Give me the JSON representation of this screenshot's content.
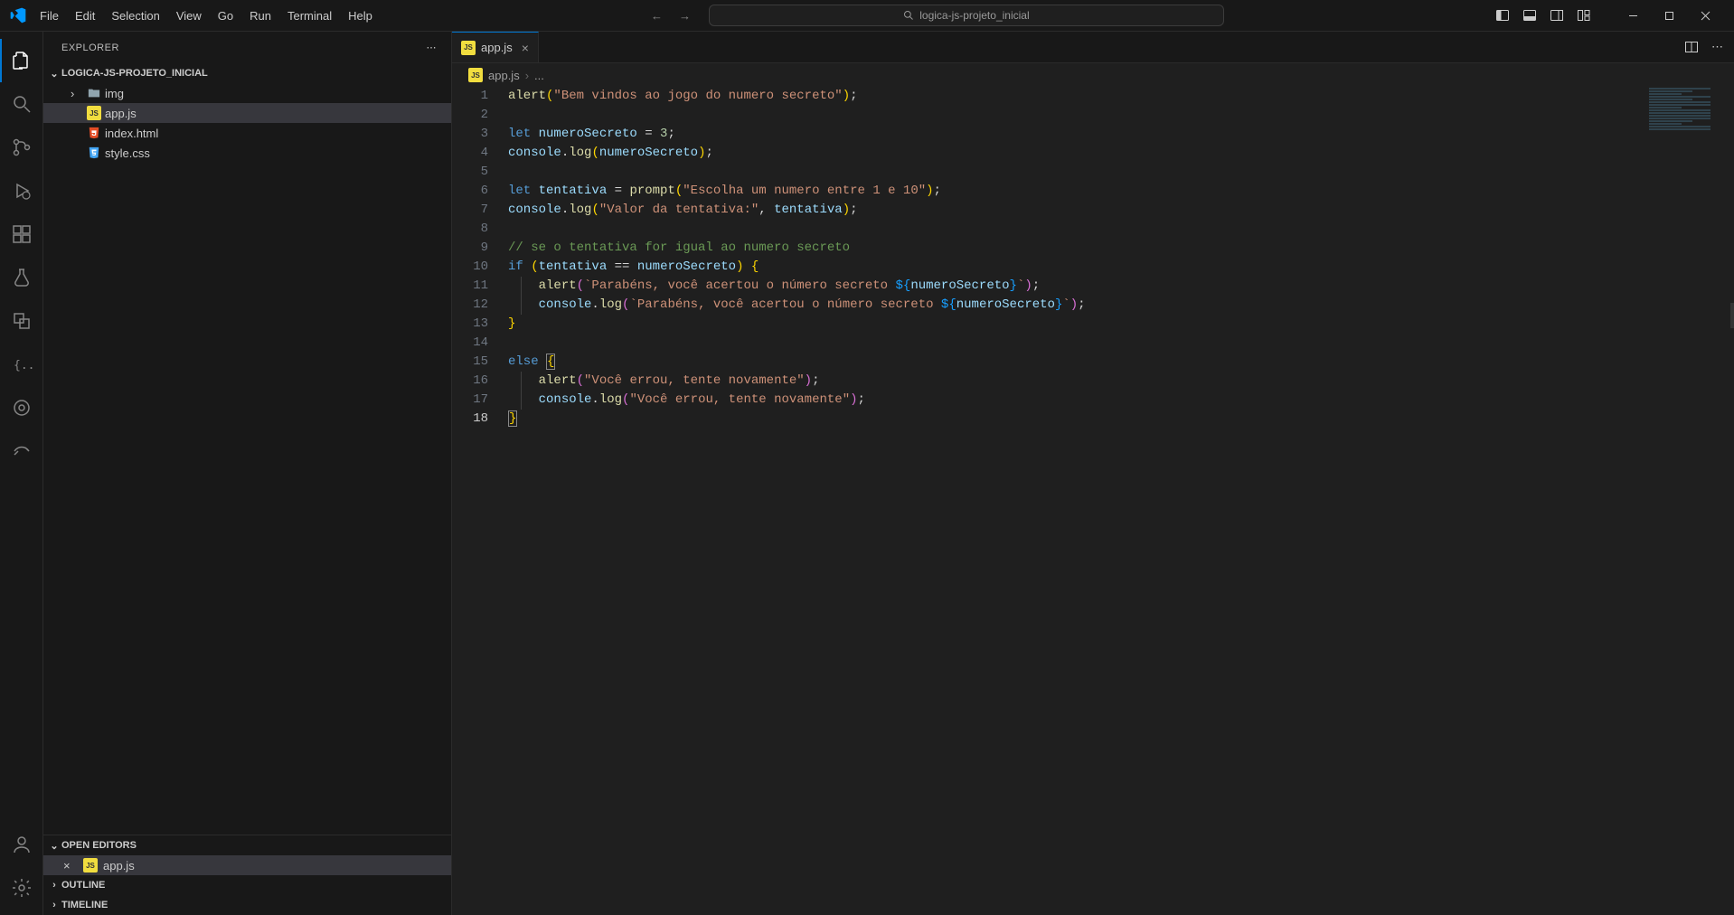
{
  "menu": [
    "File",
    "Edit",
    "Selection",
    "View",
    "Go",
    "Run",
    "Terminal",
    "Help"
  ],
  "search_placeholder": "logica-js-projeto_inicial",
  "sidebar": {
    "title": "EXPLORER",
    "project": "LOGICA-JS-PROJETO_INICIAL",
    "tree": {
      "folder": "img",
      "files": [
        "app.js",
        "index.html",
        "style.css"
      ]
    },
    "sections": {
      "open_editors": "OPEN EDITORS",
      "outline": "OUTLINE",
      "timeline": "TIMELINE"
    },
    "open_file": "app.js"
  },
  "tab": {
    "name": "app.js"
  },
  "breadcrumbs": {
    "file": "app.js",
    "rest": "..."
  },
  "code": {
    "lines": [
      {
        "n": 1,
        "segs": [
          {
            "t": "alert",
            "c": "tok-fn"
          },
          {
            "t": "(",
            "c": "tok-br"
          },
          {
            "t": "\"Bem vindos ao jogo do numero secreto\"",
            "c": "tok-str"
          },
          {
            "t": ")",
            "c": "tok-br"
          },
          {
            "t": ";",
            "c": "tok-pn"
          }
        ]
      },
      {
        "n": 2,
        "segs": []
      },
      {
        "n": 3,
        "segs": [
          {
            "t": "let ",
            "c": "tok-kw"
          },
          {
            "t": "numeroSecreto",
            "c": "tok-var"
          },
          {
            "t": " = ",
            "c": "tok-pn"
          },
          {
            "t": "3",
            "c": "tok-num"
          },
          {
            "t": ";",
            "c": "tok-pn"
          }
        ]
      },
      {
        "n": 4,
        "segs": [
          {
            "t": "console",
            "c": "tok-var"
          },
          {
            "t": ".",
            "c": "tok-pn"
          },
          {
            "t": "log",
            "c": "tok-fn"
          },
          {
            "t": "(",
            "c": "tok-br"
          },
          {
            "t": "numeroSecreto",
            "c": "tok-var"
          },
          {
            "t": ")",
            "c": "tok-br"
          },
          {
            "t": ";",
            "c": "tok-pn"
          }
        ]
      },
      {
        "n": 5,
        "segs": []
      },
      {
        "n": 6,
        "segs": [
          {
            "t": "let ",
            "c": "tok-kw"
          },
          {
            "t": "tentativa",
            "c": "tok-var"
          },
          {
            "t": " = ",
            "c": "tok-pn"
          },
          {
            "t": "prompt",
            "c": "tok-fn"
          },
          {
            "t": "(",
            "c": "tok-br"
          },
          {
            "t": "\"Escolha um numero entre 1 e 10\"",
            "c": "tok-str"
          },
          {
            "t": ")",
            "c": "tok-br"
          },
          {
            "t": ";",
            "c": "tok-pn"
          }
        ]
      },
      {
        "n": 7,
        "segs": [
          {
            "t": "console",
            "c": "tok-var"
          },
          {
            "t": ".",
            "c": "tok-pn"
          },
          {
            "t": "log",
            "c": "tok-fn"
          },
          {
            "t": "(",
            "c": "tok-br"
          },
          {
            "t": "\"Valor da tentativa:\"",
            "c": "tok-str"
          },
          {
            "t": ", ",
            "c": "tok-pn"
          },
          {
            "t": "tentativa",
            "c": "tok-var"
          },
          {
            "t": ")",
            "c": "tok-br"
          },
          {
            "t": ";",
            "c": "tok-pn"
          }
        ]
      },
      {
        "n": 8,
        "segs": []
      },
      {
        "n": 9,
        "segs": [
          {
            "t": "// se o tentativa for igual ao numero secreto",
            "c": "tok-cmt"
          }
        ]
      },
      {
        "n": 10,
        "segs": [
          {
            "t": "if ",
            "c": "tok-kw"
          },
          {
            "t": "(",
            "c": "tok-br"
          },
          {
            "t": "tentativa",
            "c": "tok-var"
          },
          {
            "t": " == ",
            "c": "tok-pn"
          },
          {
            "t": "numeroSecreto",
            "c": "tok-var"
          },
          {
            "t": ")",
            "c": "tok-br"
          },
          {
            "t": " ",
            "c": ""
          },
          {
            "t": "{",
            "c": "tok-br"
          }
        ]
      },
      {
        "n": 11,
        "indent": 1,
        "segs": [
          {
            "t": "    ",
            "c": ""
          },
          {
            "t": "alert",
            "c": "tok-fn"
          },
          {
            "t": "(",
            "c": "tok-br2"
          },
          {
            "t": "`Parabéns, você acertou o número secreto ",
            "c": "tok-tmpl"
          },
          {
            "t": "${",
            "c": "tok-br3"
          },
          {
            "t": "numeroSecreto",
            "c": "tok-var"
          },
          {
            "t": "}",
            "c": "tok-br3"
          },
          {
            "t": "`",
            "c": "tok-tmpl"
          },
          {
            "t": ")",
            "c": "tok-br2"
          },
          {
            "t": ";",
            "c": "tok-pn"
          }
        ]
      },
      {
        "n": 12,
        "indent": 1,
        "segs": [
          {
            "t": "    ",
            "c": ""
          },
          {
            "t": "console",
            "c": "tok-var"
          },
          {
            "t": ".",
            "c": "tok-pn"
          },
          {
            "t": "log",
            "c": "tok-fn"
          },
          {
            "t": "(",
            "c": "tok-br2"
          },
          {
            "t": "`Parabéns, você acertou o número secreto ",
            "c": "tok-tmpl"
          },
          {
            "t": "${",
            "c": "tok-br3"
          },
          {
            "t": "numeroSecreto",
            "c": "tok-var"
          },
          {
            "t": "}",
            "c": "tok-br3"
          },
          {
            "t": "`",
            "c": "tok-tmpl"
          },
          {
            "t": ")",
            "c": "tok-br2"
          },
          {
            "t": ";",
            "c": "tok-pn"
          }
        ]
      },
      {
        "n": 13,
        "segs": [
          {
            "t": "}",
            "c": "tok-br"
          }
        ]
      },
      {
        "n": 14,
        "segs": []
      },
      {
        "n": 15,
        "segs": [
          {
            "t": "else ",
            "c": "tok-kw"
          },
          {
            "t": "{",
            "c": "tok-br",
            "boxed": true
          }
        ]
      },
      {
        "n": 16,
        "indent": 1,
        "segs": [
          {
            "t": "    ",
            "c": ""
          },
          {
            "t": "alert",
            "c": "tok-fn"
          },
          {
            "t": "(",
            "c": "tok-br2"
          },
          {
            "t": "\"Você errou, tente novamente\"",
            "c": "tok-str"
          },
          {
            "t": ")",
            "c": "tok-br2"
          },
          {
            "t": ";",
            "c": "tok-pn"
          }
        ]
      },
      {
        "n": 17,
        "indent": 1,
        "segs": [
          {
            "t": "    ",
            "c": ""
          },
          {
            "t": "console",
            "c": "tok-var"
          },
          {
            "t": ".",
            "c": "tok-pn"
          },
          {
            "t": "log",
            "c": "tok-fn"
          },
          {
            "t": "(",
            "c": "tok-br2"
          },
          {
            "t": "\"Você errou, tente novamente\"",
            "c": "tok-str"
          },
          {
            "t": ")",
            "c": "tok-br2"
          },
          {
            "t": ";",
            "c": "tok-pn"
          }
        ]
      },
      {
        "n": 18,
        "cur": true,
        "segs": [
          {
            "t": "}",
            "c": "tok-br",
            "boxed": true
          }
        ]
      }
    ]
  }
}
